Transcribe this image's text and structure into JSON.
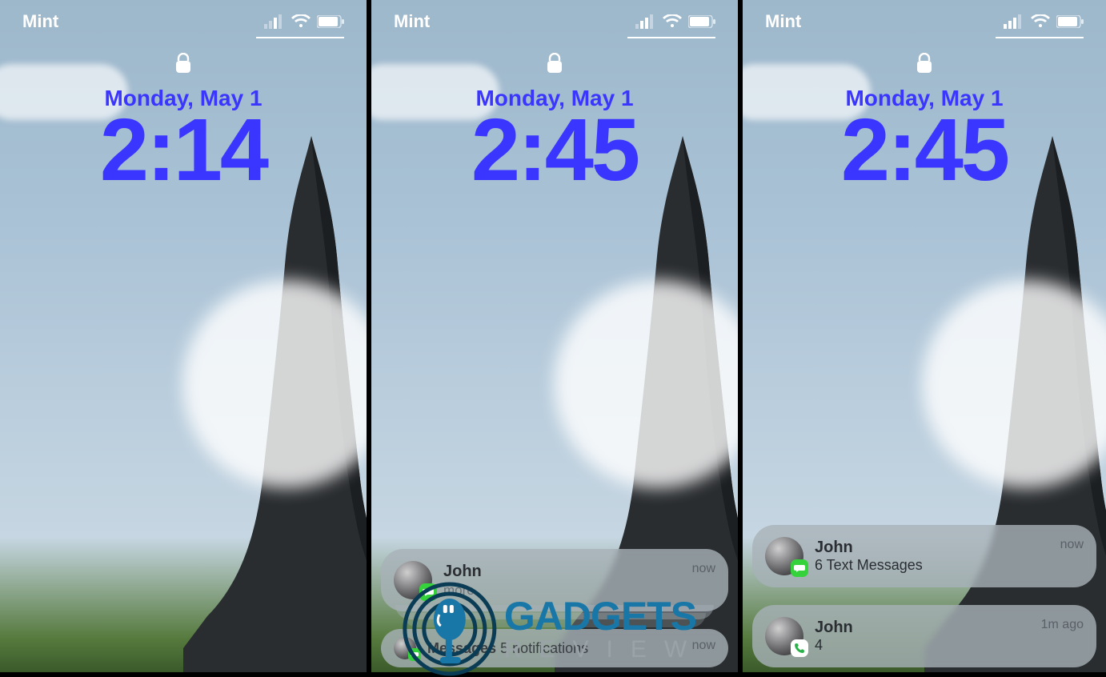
{
  "brand_watermark": {
    "gadgets": "GADGETS",
    "review": "REVIEW"
  },
  "screens": [
    {
      "carrier": "Mint",
      "date": "Monday, May 1",
      "time": "2:14",
      "notifications": [],
      "summary": null
    },
    {
      "carrier": "Mint",
      "date": "Monday, May 1",
      "time": "2:45",
      "notifications": [
        {
          "sender": "John",
          "body": "",
          "more": "more",
          "meta": "now",
          "badge": "messages",
          "stacked": true
        }
      ],
      "summary": {
        "label": "Messages",
        "count": "5 notifications",
        "meta": "now"
      }
    },
    {
      "carrier": "Mint",
      "date": "Monday, May 1",
      "time": "2:45",
      "notifications": [
        {
          "sender": "John",
          "body": "6 Text Messages",
          "meta": "now",
          "badge": "messages",
          "stacked": false
        },
        {
          "sender": "John",
          "body": "4",
          "meta": "1m ago",
          "badge": "phone",
          "stacked": false
        }
      ],
      "summary": null
    }
  ]
}
